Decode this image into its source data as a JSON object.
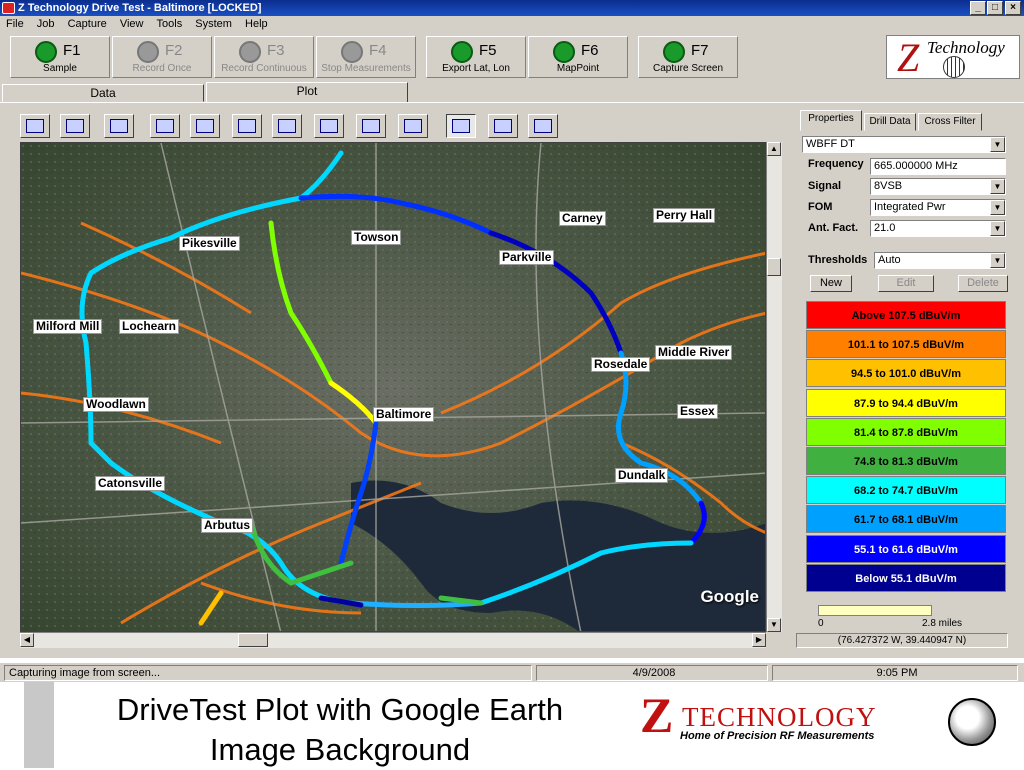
{
  "window": {
    "title": "Z Technology Drive Test - Baltimore [LOCKED]",
    "min": "_",
    "max": "□",
    "close": "×"
  },
  "menu": [
    "File",
    "Job",
    "Capture",
    "View",
    "Tools",
    "System",
    "Help"
  ],
  "toolbar": [
    {
      "key": "F1",
      "label": "Sample",
      "enabled": true
    },
    {
      "key": "F2",
      "label": "Record Once",
      "enabled": false
    },
    {
      "key": "F3",
      "label": "Record Continuous",
      "enabled": false
    },
    {
      "key": "F4",
      "label": "Stop Measurements",
      "enabled": false
    },
    {
      "key": "F5",
      "label": "Export Lat, Lon",
      "enabled": true
    },
    {
      "key": "F6",
      "label": "MapPoint",
      "enabled": true
    },
    {
      "key": "F7",
      "label": "Capture Screen",
      "enabled": true
    }
  ],
  "logo_top": {
    "z": "Z",
    "text": "Technology"
  },
  "tabs": [
    {
      "label": "Data"
    },
    {
      "label": "Plot",
      "active": true
    }
  ],
  "map": {
    "attribution": "Google",
    "towns": [
      "Pikesville",
      "Towson",
      "Carney",
      "Perry Hall",
      "Parkville",
      "Milford Mill",
      "Lochearn",
      "Rosedale",
      "Middle River",
      "Woodlawn",
      "Baltimore",
      "Essex",
      "Dundalk",
      "Catonsville",
      "Arbutus"
    ]
  },
  "right_panel": {
    "tabs": [
      "Properties",
      "Drill Data",
      "Cross Filter"
    ],
    "station": "WBFF DT",
    "fields": [
      {
        "label": "Frequency",
        "value": "665.000000 MHz"
      },
      {
        "label": "Signal",
        "value": "8VSB"
      },
      {
        "label": "FOM",
        "value": "Integrated Pwr"
      },
      {
        "label": "Ant. Fact.",
        "value": "21.0"
      }
    ],
    "thresholds_label": "Thresholds",
    "thresholds_value": "Auto",
    "buttons": [
      "New",
      "Edit",
      "Delete"
    ],
    "legend": [
      {
        "label": "Above 107.5 dBuV/m",
        "color": "#ff0000"
      },
      {
        "label": "101.1 to 107.5 dBuV/m",
        "color": "#ff8000"
      },
      {
        "label": "94.5 to 101.0 dBuV/m",
        "color": "#ffc000"
      },
      {
        "label": "87.9 to 94.4 dBuV/m",
        "color": "#ffff00"
      },
      {
        "label": "81.4 to 87.8 dBuV/m",
        "color": "#80ff00"
      },
      {
        "label": "74.8 to 81.3 dBuV/m",
        "color": "#40b040"
      },
      {
        "label": "68.2 to 74.7 dBuV/m",
        "color": "#00ffff"
      },
      {
        "label": "61.7 to 68.1 dBuV/m",
        "color": "#00a0ff"
      },
      {
        "label": "55.1 to 61.6 dBuV/m",
        "color": "#0000ff"
      },
      {
        "label": "Below 55.1 dBuV/m",
        "color": "#000090"
      }
    ],
    "scale_start": "0",
    "scale_end": "2.8 miles",
    "coordinates": "(76.427372 W, 39.440947 N)"
  },
  "status": {
    "message": "Capturing image from screen...",
    "date": "4/9/2008",
    "time": "9:05 PM"
  },
  "slide": {
    "caption_line1": "DriveTest Plot with Google Earth",
    "caption_line2": "Image Background",
    "logo_z": "Z",
    "logo_text": "TECHNOLOGY",
    "logo_tagline": "Home of Precision RF Measurements"
  }
}
